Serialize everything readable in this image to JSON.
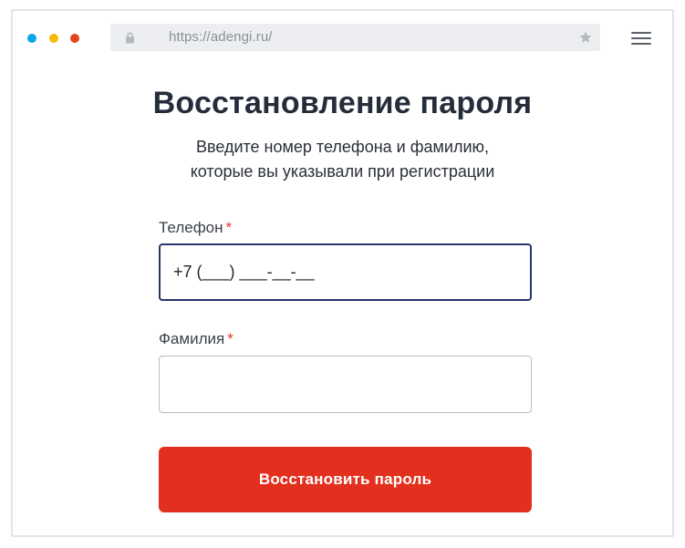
{
  "browser": {
    "url": "https://adengi.ru/",
    "icons": {
      "lock": "lock-icon",
      "star": "star-icon",
      "menu": "hamburger-menu-icon"
    },
    "traffic_lights": [
      "#0aa6ee",
      "#f5b90b",
      "#e54518"
    ]
  },
  "page": {
    "title": "Восстановление пароля",
    "subtitle_line1": "Введите номер телефона и фамилию,",
    "subtitle_line2": "которые вы указывали при регистрации"
  },
  "form": {
    "phone": {
      "label": "Телефон",
      "required_mark": "*",
      "value": "+7 (___) ___-__-__"
    },
    "surname": {
      "label": "Фамилия",
      "required_mark": "*",
      "value": ""
    },
    "submit_label": "Восстановить пароль"
  },
  "colors": {
    "accent": "#e3301e",
    "title": "#252d3b",
    "focus_border": "#27366b",
    "required": "#e33a24"
  }
}
